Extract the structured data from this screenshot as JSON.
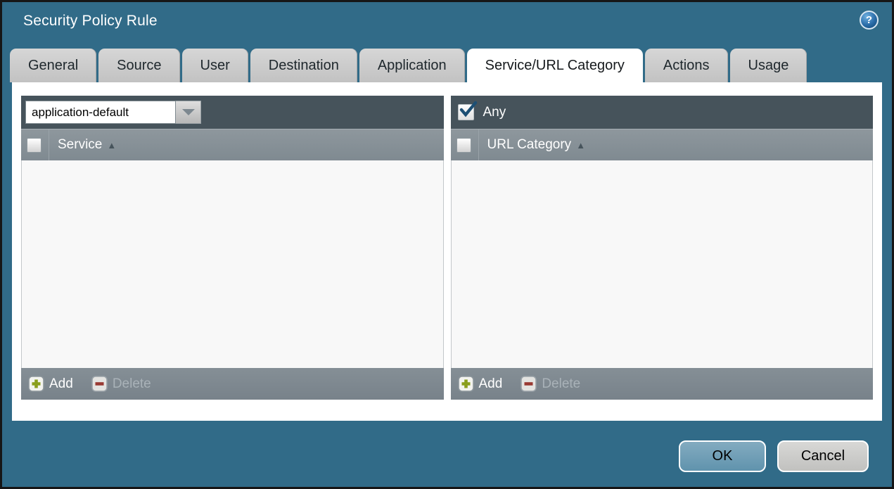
{
  "dialog": {
    "title": "Security Policy Rule"
  },
  "tabs": [
    {
      "label": "General",
      "active": false
    },
    {
      "label": "Source",
      "active": false
    },
    {
      "label": "User",
      "active": false
    },
    {
      "label": "Destination",
      "active": false
    },
    {
      "label": "Application",
      "active": false
    },
    {
      "label": "Service/URL Category",
      "active": true
    },
    {
      "label": "Actions",
      "active": false
    },
    {
      "label": "Usage",
      "active": false
    }
  ],
  "service_panel": {
    "dropdown_value": "application-default",
    "column_header": "Service",
    "rows": [],
    "add_label": "Add",
    "delete_label": "Delete",
    "delete_enabled": false
  },
  "url_category_panel": {
    "any_label": "Any",
    "any_checked": true,
    "column_header": "URL Category",
    "rows": [],
    "add_label": "Add",
    "delete_label": "Delete",
    "delete_enabled": false
  },
  "footer": {
    "ok_label": "OK",
    "cancel_label": "Cancel"
  },
  "icons": {
    "help": "?",
    "sort_asc": "▲"
  },
  "colors": {
    "titlebar_teal": "#316b88",
    "panel_header_dark": "#46535b",
    "column_header_gray": "#868f96",
    "footer_bar_gray": "#7e8890",
    "tab_inactive_gray": "#c9c9c9",
    "tab_active_white": "#ffffff",
    "ok_button_blue": "#74a2ba",
    "add_plus_green": "#8a9e1c",
    "delete_minus_red": "#993a33",
    "checkmark_blue": "#1d4f74"
  }
}
